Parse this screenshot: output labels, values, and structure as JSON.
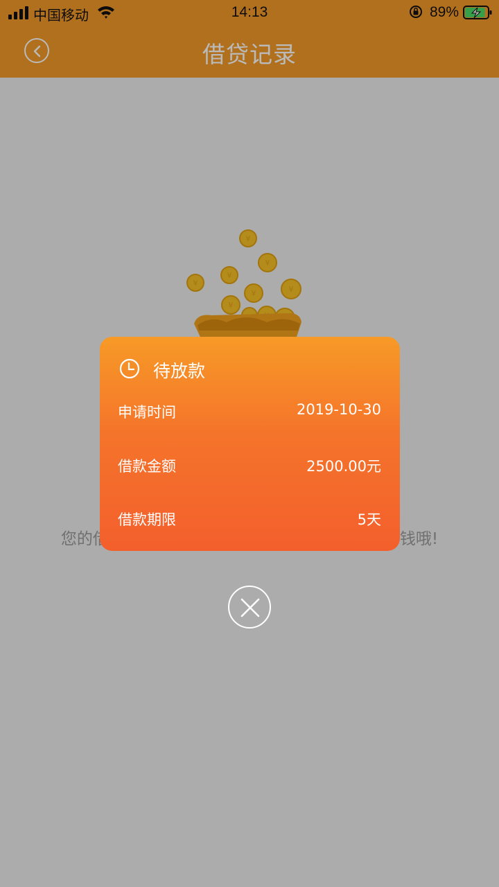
{
  "status_bar": {
    "carrier": "中国移动",
    "time": "14:13",
    "battery_percent": "89%",
    "battery_level": 0.89,
    "signal_icon": "cellular-signal-icon",
    "wifi_icon": "wifi-icon",
    "lock_icon": "orientation-lock-icon",
    "battery_icon": "battery-charging-icon"
  },
  "header": {
    "title": "借贷记录",
    "back_icon": "chevron-left-icon",
    "background": "#f39a2a"
  },
  "empty_state": {
    "message_left": "您的借",
    "message_right": "钱哦!",
    "illustration": "gold-ingot-coins-illustration"
  },
  "loan_popup": {
    "status_icon": "clock-icon",
    "status": "待放款",
    "rows": [
      {
        "label": "申请时间",
        "value": "2019-10-30"
      },
      {
        "label": "借款金额",
        "value": "2500.00元"
      },
      {
        "label": "借款期限",
        "value": "5天"
      }
    ],
    "gradient_top": "#f79a27",
    "gradient_bottom": "#f35f2c",
    "close_icon": "close-icon"
  }
}
